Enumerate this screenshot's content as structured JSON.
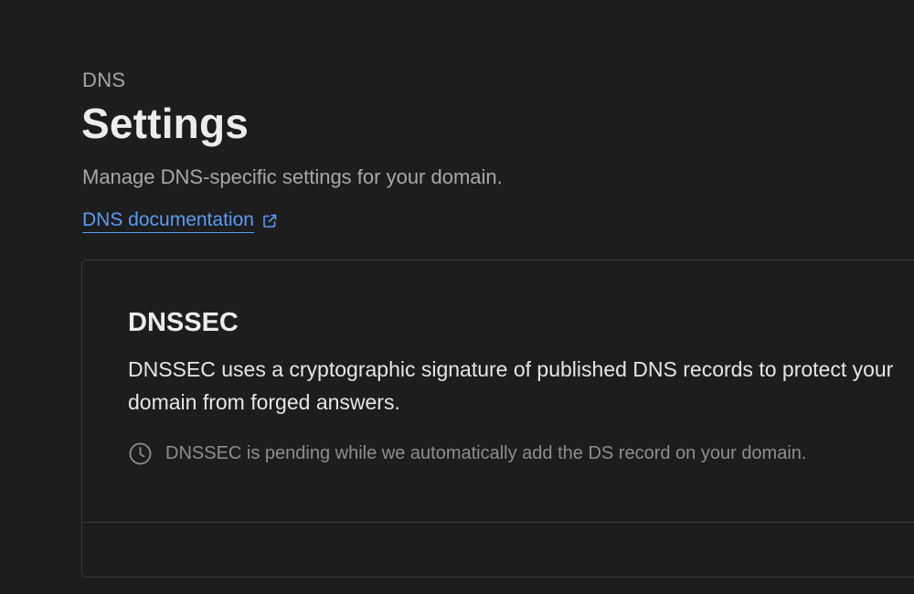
{
  "header": {
    "eyebrow": "DNS",
    "title": "Settings",
    "subtitle": "Manage DNS-specific settings for your domain.",
    "doc_link": {
      "label": "DNS documentation",
      "icon": "external-link-icon"
    }
  },
  "dnssec_card": {
    "title": "DNSSEC",
    "description": "DNSSEC uses a cryptographic signature of published DNS records to protect your domain from forged answers.",
    "status": {
      "icon": "clock-icon",
      "text": "DNSSEC is pending while we automatically add the DS record on your domain."
    }
  },
  "colors": {
    "background": "#1d1d1d",
    "link": "#5b9bf5",
    "border": "#3a3a3a",
    "muted_text": "#8e8e8e"
  }
}
